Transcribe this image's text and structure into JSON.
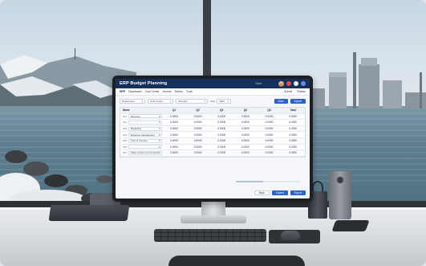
{
  "colors": {
    "app_bar": "#16305c",
    "primary_button": "#2c63c6",
    "grid_header": "#eef2f7"
  },
  "app": {
    "title": "ERP Budget Planning",
    "user": "User",
    "icons": [
      "avatar-icon",
      "alert-icon",
      "help-icon",
      "settings-icon"
    ]
  },
  "menu": {
    "items": [
      "ERP",
      "Dashboard",
      "Cost Center",
      "Income",
      "Money",
      "Tools"
    ],
    "active_index": 0,
    "right_actions": [
      "Submit",
      "Finalize"
    ]
  },
  "filters": {
    "department": "Department",
    "cost_center": "Cost Center",
    "scenario": "Scenario",
    "year_label": "Year",
    "year_value": "2023",
    "buttons": [
      "Save",
      "Export"
    ]
  },
  "grid": {
    "columns": [
      "Name",
      "Q1",
      "Q2",
      "Q3",
      "Q4",
      "Q4",
      "Total"
    ],
    "rows": [
      {
        "code": "001",
        "name": "Revenue",
        "values": [
          "0.0000",
          "0.0000",
          "0.0000",
          "0.0000",
          "0.0000",
          "0.0000"
        ]
      },
      {
        "code": "002",
        "name": "",
        "values": [
          "0.0000",
          "0.0000",
          "0.0000",
          "0.0000",
          "0.0000",
          "0.0000"
        ]
      },
      {
        "code": "003",
        "name": "Marketing",
        "values": [
          "0.0000",
          "0.0000",
          "0.0000",
          "0.0000",
          "0.0000",
          "0.0000"
        ]
      },
      {
        "code": "004",
        "name": "Expense management",
        "values": [
          "0.0000",
          "0.0000",
          "0.0000",
          "0.0000",
          "0.0000",
          "0.0000"
        ]
      },
      {
        "code": "005",
        "name": "Cost of revenue",
        "values": [
          "0.0000",
          "0.0000",
          "0.0000",
          "0.0000",
          "0.0000",
          "0.0000"
        ]
      },
      {
        "code": "006",
        "name": "",
        "values": [
          "0.0000",
          "0.0000",
          "0.0000",
          "0.0000",
          "0.0000",
          "0.0000"
        ]
      },
      {
        "code": "007",
        "name": "Other income (noncontrol)",
        "values": [
          "0.0000",
          "0.0000",
          "0.0000",
          "0.0000",
          "0.0000",
          "0.0000"
        ]
      }
    ]
  },
  "footer": {
    "buttons": [
      "Back",
      "Submit",
      "Export"
    ]
  }
}
